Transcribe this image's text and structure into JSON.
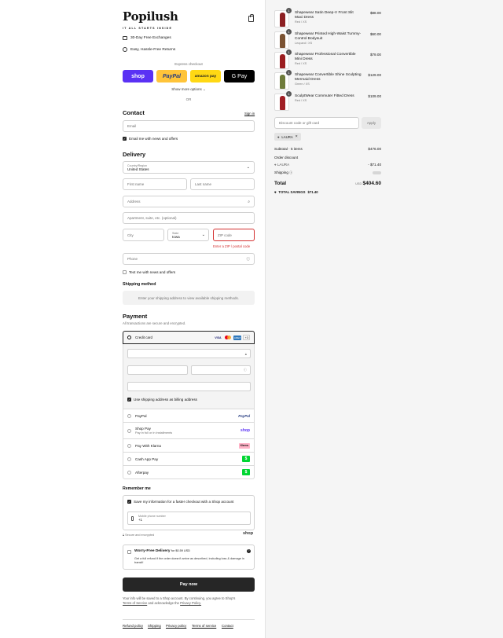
{
  "brand": {
    "name": "Popilush",
    "tagline": "IT ALL STARTS INSIDE"
  },
  "perks": [
    "30-Day Free Exchanges",
    "Easy, Hassle-Free Returns"
  ],
  "express": {
    "title": "Express checkout",
    "buttons": [
      "shop",
      "PayPal",
      "amazon pay",
      "G Pay"
    ],
    "more": "Show more options",
    "or": "OR"
  },
  "contact": {
    "title": "Contact",
    "sign_in": "Sign in",
    "email_placeholder": "Email",
    "news_label": "Email me with news and offers"
  },
  "delivery": {
    "title": "Delivery",
    "country_label": "Country/Region",
    "country_value": "United States",
    "first_name": "First name",
    "last_name": "Last name",
    "address": "Address",
    "apartment": "Apartment, suite, etc. (optional)",
    "city": "City",
    "state_label": "State",
    "state_value": "Iowa",
    "zip": "ZIP code",
    "zip_error": "Enter a ZIP / postal code",
    "phone": "Phone",
    "text_label": "Text me with news and offers"
  },
  "shipping": {
    "title": "Shipping method",
    "note": "Enter your shipping address to view available shipping methods."
  },
  "payment": {
    "title": "Payment",
    "subtitle": "All transactions are secure and encrypted.",
    "credit_card": "Credit card",
    "card_badges": [
      "VISA",
      "MC",
      "AMEX",
      "+3"
    ],
    "billing_label": "Use shipping address as billing address",
    "methods": [
      {
        "label": "PayPal",
        "sub": "",
        "tag": "PayPal"
      },
      {
        "label": "Shop Pay",
        "sub": "Pay in full or in installments",
        "tag": "shop"
      },
      {
        "label": "Pay With Klarna",
        "sub": "",
        "tag": "Klarna."
      },
      {
        "label": "Cash App Pay",
        "sub": "",
        "tag": "$"
      },
      {
        "label": "Afterpay",
        "sub": "",
        "tag": "$"
      }
    ]
  },
  "remember": {
    "title": "Remember me",
    "save_label": "Save my information for a faster checkout with a Shop account",
    "phone_label": "Mobile phone number",
    "phone_value": "+1",
    "secure": "Secure and encrypted",
    "shop_logo": "shop"
  },
  "worry_free": {
    "title": "Worry-Free Delivery",
    "price": "for $0.59 USD",
    "desc": "Get a full refund if the order doesn't arrive as described, including loss & damage in transit!"
  },
  "pay_now": "Pay now",
  "legal": {
    "text": "Your info will be saved to a Shop account. By continuing, you agree to Shop's",
    "tos": "Terms of Service",
    "and": "and acknowledge the",
    "privacy": "Privacy Policy."
  },
  "footer_links": [
    "Refund policy",
    "Shipping",
    "Privacy policy",
    "Terms of service",
    "Contact"
  ],
  "cart": {
    "items": [
      {
        "qty": "1",
        "name": "Shapewear Satin Deep-V Front Slit Maxi Dress",
        "variant": "Red / XS",
        "price": "$88.00",
        "color": "#8c1f22"
      },
      {
        "qty": "1",
        "name": "Shapewear Printed High-Waist Tummy-Control Bodysuit",
        "variant": "Leopard / XS",
        "price": "$60.00",
        "color": "#7a5232"
      },
      {
        "qty": "1",
        "name": "Shapewear Professional Convertible Mini Dress",
        "variant": "Red / XS",
        "price": "$79.00",
        "color": "#9b1d20"
      },
      {
        "qty": "1",
        "name": "Shapewear Convertible Shine Sculpting Mermaid Dress",
        "variant": "Green / XS",
        "price": "$129.00",
        "color": "#6e7b3a"
      },
      {
        "qty": "1",
        "name": "SculptWear Commuter Fitted Dress",
        "variant": "Red / XS",
        "price": "$109.00",
        "color": "#a01e24"
      }
    ],
    "discount_placeholder": "Discount code or gift card",
    "apply": "Apply",
    "code": "LAURA",
    "subtotal_label": "Subtotal · 5 items",
    "subtotal": "$476.00",
    "order_discount": "Order discount",
    "discount_code": "LAURA",
    "discount_amount": "- $71.40",
    "shipping_label": "Shipping",
    "total_label": "Total",
    "currency": "USD",
    "total": "$404.60",
    "savings_label": "TOTAL SAVINGS",
    "savings": "$71.40"
  }
}
